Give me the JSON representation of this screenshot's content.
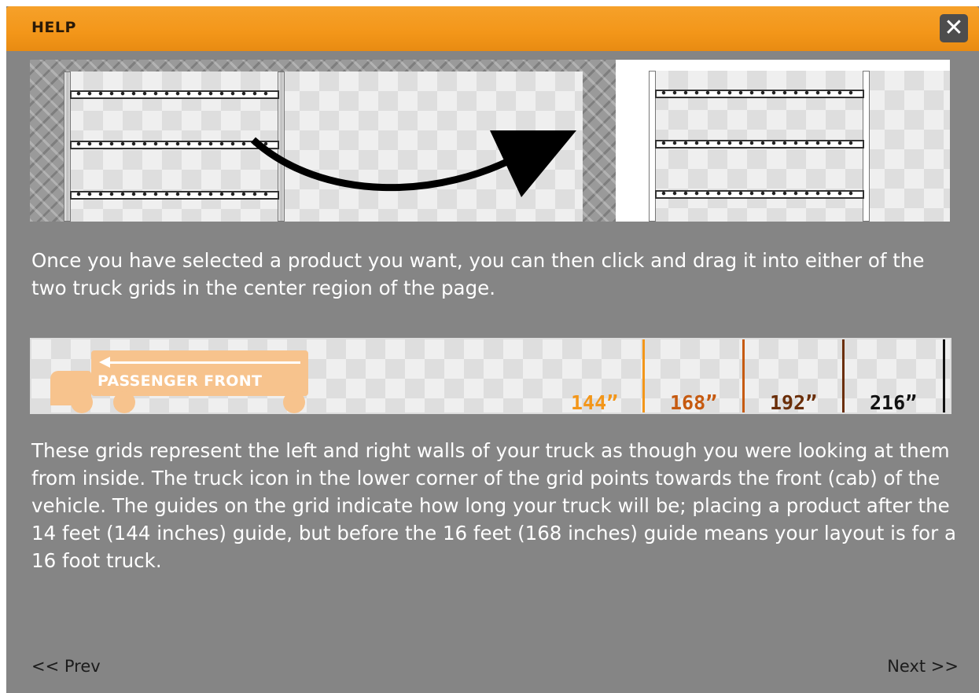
{
  "dialog": {
    "title": "HELP",
    "close_glyph": "✕"
  },
  "hero": {
    "description": "illustration-drag-product-into-grid"
  },
  "text": {
    "para1": "Once you have selected a product you want, you can then click and drag it into either of the two truck grids in the center region of the page.",
    "para2": "These grids represent the left and right walls of your truck as though you were looking at them from inside. The truck icon in the lower corner of the grid points towards the front (cab) of the vehicle. The guides on the grid indicate how long your truck will be; placing a product after the 14 feet (144 inches) guide, but before the 16 feet (168 inches) guide means your layout is for a 16 foot truck."
  },
  "strip": {
    "truck_label": "PASSENGER FRONT",
    "markers": [
      {
        "label": "144”",
        "color": "#f39619"
      },
      {
        "label": "168”",
        "color": "#c65a10"
      },
      {
        "label": "192”",
        "color": "#6a2e08"
      },
      {
        "label": "216”",
        "color": "#111111"
      }
    ]
  },
  "nav": {
    "prev": "<< Prev",
    "next": "Next >>"
  }
}
